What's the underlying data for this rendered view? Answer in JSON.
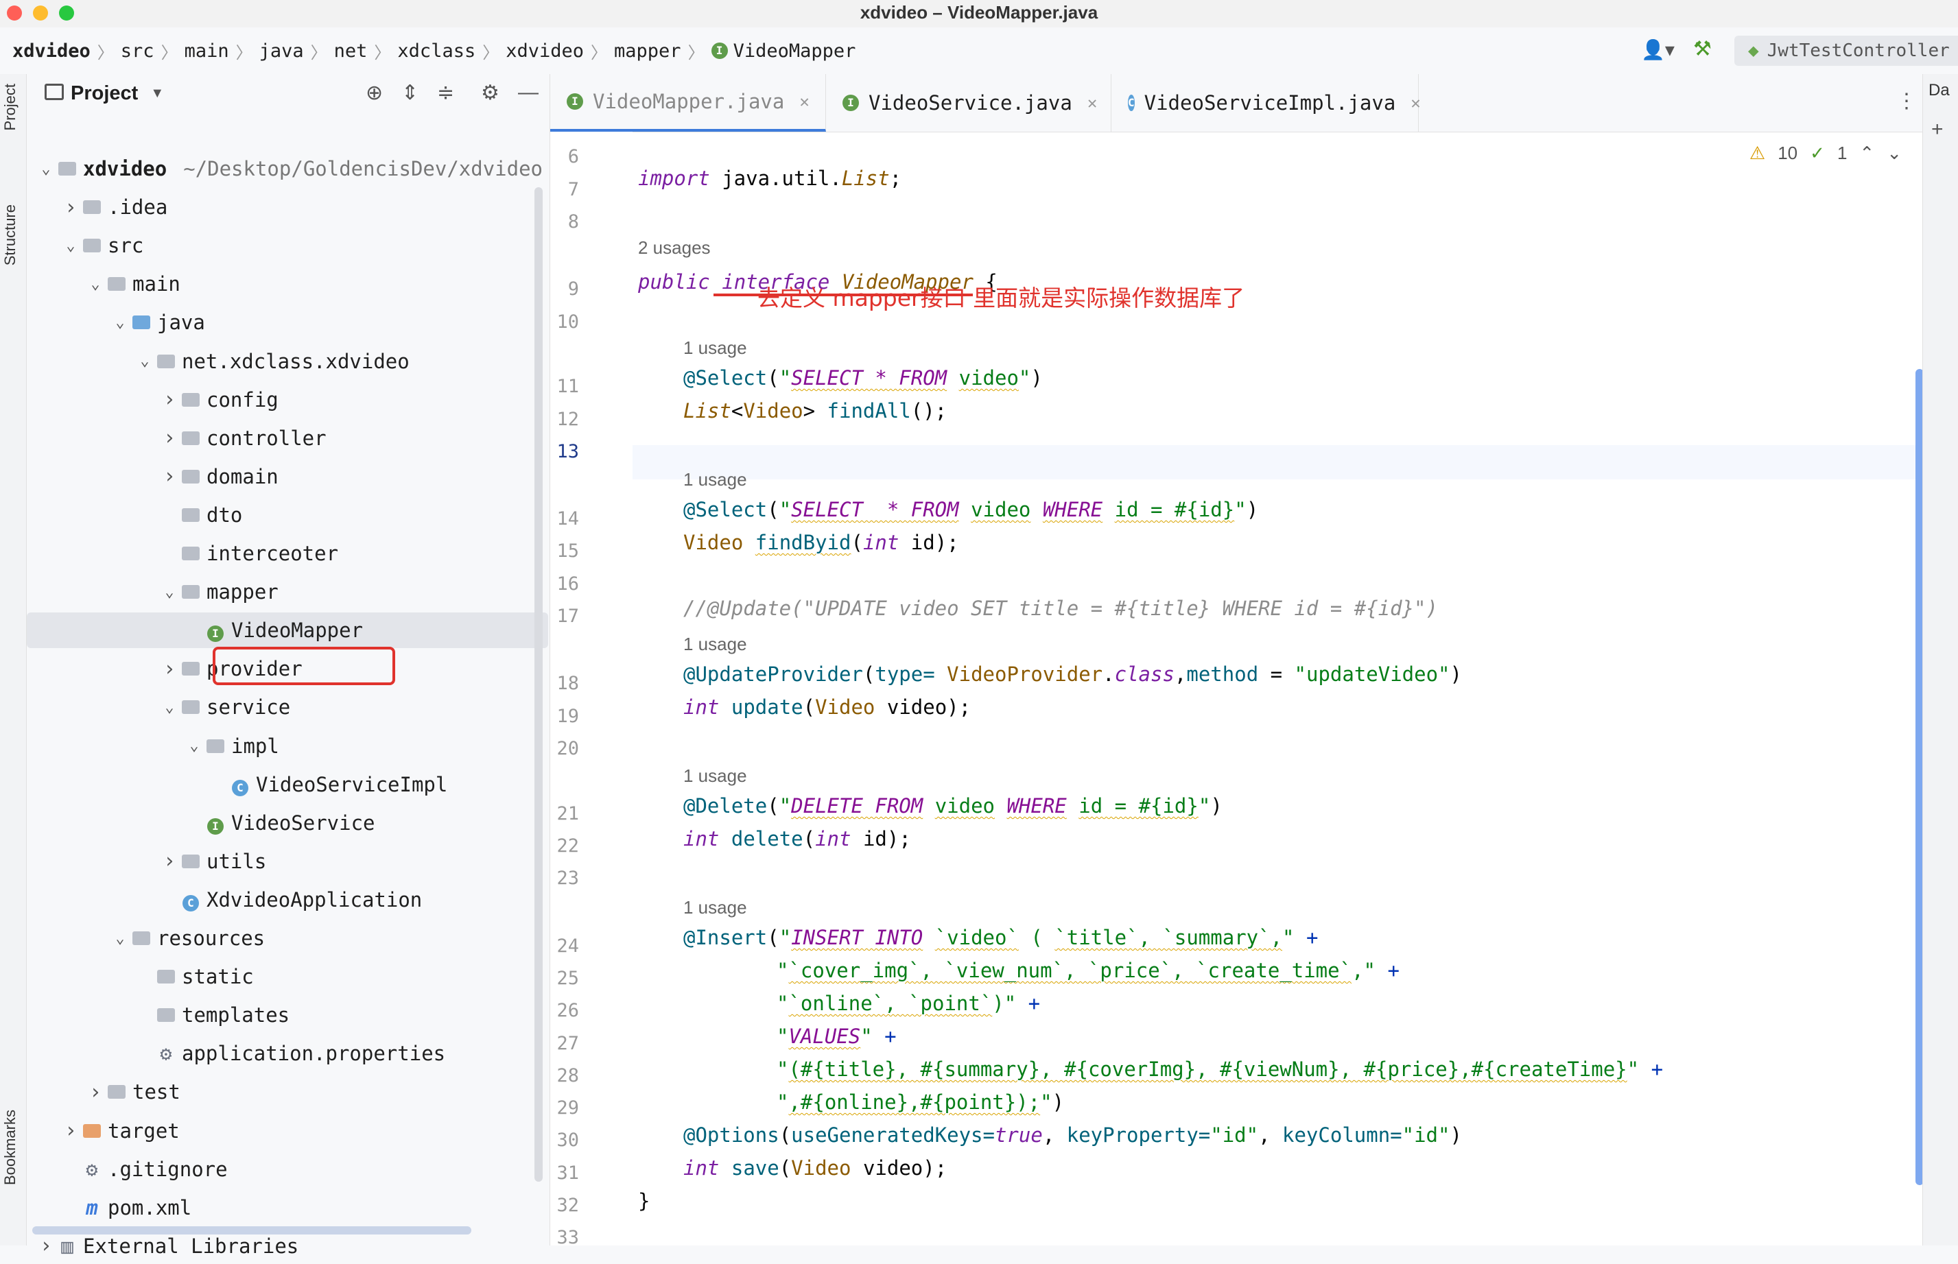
{
  "window": {
    "title": "xdvideo – VideoMapper.java"
  },
  "breadcrumb": [
    "xdvideo",
    "src",
    "main",
    "java",
    "net",
    "xdclass",
    "xdvideo",
    "mapper",
    "VideoMapper"
  ],
  "run_config": {
    "label": "JwtTestController"
  },
  "left_strip": {
    "project": "Project",
    "structure": "Structure",
    "bookmarks": "Bookmarks"
  },
  "project": {
    "title": "Project",
    "tree": [
      {
        "label": "xdvideo",
        "extra": "~/Desktop/GoldencisDev/xdvideo",
        "depth": 0,
        "icon": "module",
        "open": true
      },
      {
        "label": ".idea",
        "depth": 1,
        "icon": "folder",
        "open": false
      },
      {
        "label": "src",
        "depth": 1,
        "icon": "folder",
        "open": true
      },
      {
        "label": "main",
        "depth": 2,
        "icon": "folder",
        "open": true
      },
      {
        "label": "java",
        "depth": 3,
        "icon": "folder-blue",
        "open": true
      },
      {
        "label": "net.xdclass.xdvideo",
        "depth": 4,
        "icon": "package",
        "open": true
      },
      {
        "label": "config",
        "depth": 5,
        "icon": "package",
        "open": false
      },
      {
        "label": "controller",
        "depth": 5,
        "icon": "package",
        "open": false
      },
      {
        "label": "domain",
        "depth": 5,
        "icon": "package",
        "open": false
      },
      {
        "label": "dto",
        "depth": 5,
        "icon": "package"
      },
      {
        "label": "interceoter",
        "depth": 5,
        "icon": "package"
      },
      {
        "label": "mapper",
        "depth": 5,
        "icon": "package",
        "open": true
      },
      {
        "label": "VideoMapper",
        "depth": 6,
        "icon": "interface",
        "selected": true
      },
      {
        "label": "provider",
        "depth": 5,
        "icon": "package",
        "open": false
      },
      {
        "label": "service",
        "depth": 5,
        "icon": "package",
        "open": true
      },
      {
        "label": "impl",
        "depth": 6,
        "icon": "package",
        "open": true
      },
      {
        "label": "VideoServiceImpl",
        "depth": 7,
        "icon": "class"
      },
      {
        "label": "VideoService",
        "depth": 6,
        "icon": "interface"
      },
      {
        "label": "utils",
        "depth": 5,
        "icon": "package",
        "open": false
      },
      {
        "label": "XdvideoApplication",
        "depth": 5,
        "icon": "class"
      },
      {
        "label": "resources",
        "depth": 3,
        "icon": "folder",
        "open": true
      },
      {
        "label": "static",
        "depth": 4,
        "icon": "folder"
      },
      {
        "label": "templates",
        "depth": 4,
        "icon": "folder"
      },
      {
        "label": "application.properties",
        "depth": 4,
        "icon": "file"
      },
      {
        "label": "test",
        "depth": 2,
        "icon": "folder",
        "open": false
      },
      {
        "label": "target",
        "depth": 1,
        "icon": "folder-orange",
        "open": false
      },
      {
        "label": ".gitignore",
        "depth": 1,
        "icon": "file"
      },
      {
        "label": "pom.xml",
        "depth": 1,
        "icon": "maven"
      },
      {
        "label": "External Libraries",
        "depth": 0,
        "icon": "library",
        "open": false
      }
    ]
  },
  "tabs": [
    {
      "label": "VideoMapper.java",
      "icon": "interface",
      "active": true
    },
    {
      "label": "VideoService.java",
      "icon": "interface"
    },
    {
      "label": "VideoServiceImpl.java",
      "icon": "class"
    }
  ],
  "inspection": {
    "warnings": "10",
    "ok": "1"
  },
  "annotation_note": "去定义 mapper接口 里面就是实际操作数据库了",
  "code": {
    "hints": {
      "usages2": "2 usages",
      "usage1": "1 usage"
    },
    "line_numbers": [
      "6",
      "7",
      "8",
      "9",
      "10",
      "11",
      "12",
      "13",
      "14",
      "15",
      "16",
      "17",
      "18",
      "19",
      "20",
      "21",
      "22",
      "23",
      "24",
      "25",
      "26",
      "27",
      "28",
      "29",
      "30",
      "31",
      "32",
      "33"
    ]
  }
}
